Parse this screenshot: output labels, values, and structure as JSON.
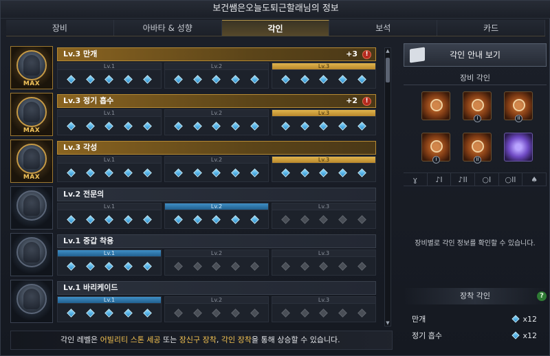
{
  "window": {
    "title": "보건쌤은오늘도퇴근할래님의 정보"
  },
  "tabs": [
    {
      "label": "장비",
      "active": false
    },
    {
      "label": "아바타 & 성향",
      "active": false
    },
    {
      "label": "각인",
      "active": true
    },
    {
      "label": "보석",
      "active": false
    },
    {
      "label": "카드",
      "active": false
    }
  ],
  "engravings": [
    {
      "title": "Lv.3 만개",
      "bonus": "+3",
      "alert": "!",
      "max_label": "MAX",
      "level": 3,
      "levels": [
        "Lv.1",
        "Lv.2",
        "Lv.3"
      ],
      "filled_per_level": [
        5,
        5,
        5
      ]
    },
    {
      "title": "Lv.3 정기 흡수",
      "bonus": "+2",
      "alert": "!",
      "max_label": "MAX",
      "level": 3,
      "levels": [
        "Lv.1",
        "Lv.2",
        "Lv.3"
      ],
      "filled_per_level": [
        5,
        5,
        5
      ]
    },
    {
      "title": "Lv.3 각성",
      "bonus": "",
      "alert": "",
      "max_label": "MAX",
      "level": 3,
      "levels": [
        "Lv.1",
        "Lv.2",
        "Lv.3"
      ],
      "filled_per_level": [
        5,
        5,
        5
      ]
    },
    {
      "title": "Lv.2 전문의",
      "bonus": "",
      "alert": "",
      "max_label": "",
      "level": 2,
      "levels": [
        "Lv.1",
        "Lv.2",
        "Lv.3"
      ],
      "filled_per_level": [
        5,
        5,
        0
      ]
    },
    {
      "title": "Lv.1 중갑 착용",
      "bonus": "",
      "alert": "",
      "max_label": "",
      "level": 1,
      "levels": [
        "Lv.1",
        "Lv.2",
        "Lv.3"
      ],
      "filled_per_level": [
        5,
        0,
        0
      ]
    },
    {
      "title": "Lv.1 바리케이드",
      "bonus": "",
      "alert": "",
      "max_label": "",
      "level": 1,
      "levels": [
        "Lv.1",
        "Lv.2",
        "Lv.3"
      ],
      "filled_per_level": [
        5,
        0,
        0
      ]
    }
  ],
  "footer": {
    "part1": "각인 레벨은 ",
    "hl1": "어빌리티 스톤 세공",
    "part2": " 또는 ",
    "hl2": "장신구 장착",
    "part3": ", ",
    "hl3": "각인 장착",
    "part4": "을 통해 상승할 수 있습니다."
  },
  "right_panel": {
    "guide_button": "각인 안내 보기",
    "equip_title": "장비 각인",
    "equip_slots": [
      {
        "icon": "necklace-icon",
        "num": ""
      },
      {
        "icon": "earring-icon",
        "num": "I"
      },
      {
        "icon": "earring-icon",
        "num": "II"
      },
      {
        "icon": "ring-icon",
        "num": "I"
      },
      {
        "icon": "ring-icon",
        "num": "II"
      },
      {
        "icon": "ability-stone-icon",
        "num": ""
      }
    ],
    "accessory_tabs": [
      "ɣ",
      "♪I",
      "♪II",
      "○I",
      "○II",
      "♠"
    ],
    "info_message": "장비별로 각인 정보를 확인할 수 있습니다.",
    "mounted_title": "장착 각인",
    "help": "?",
    "mounted": [
      {
        "name": "만개",
        "count": "x12"
      },
      {
        "name": "정기 흡수",
        "count": "x12"
      }
    ]
  }
}
